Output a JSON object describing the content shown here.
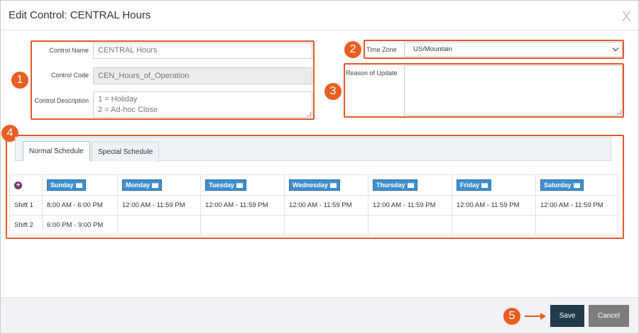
{
  "dialog": {
    "title": "Edit Control: CENTRAL Hours",
    "close_glyph": "X"
  },
  "callouts": [
    "1",
    "2",
    "3",
    "4",
    "5"
  ],
  "form": {
    "control_name_label": "Control Name",
    "control_name_value": "CENTRAL Hours",
    "control_code_label": "Control Code",
    "control_code_value": "CEN_Hours_of_Operation",
    "control_description_label": "Control Description",
    "control_description_line1": "1 = Holiday",
    "control_description_line2": "2 = Ad-hoc Close",
    "time_zone_label": "Time Zone",
    "time_zone_value": "US/Mountain",
    "reason_label": "Reason of Update",
    "reason_value": ""
  },
  "tabs": [
    {
      "label": "Normal Schedule",
      "active": true
    },
    {
      "label": "Special Schedule",
      "active": false
    }
  ],
  "schedule": {
    "days": [
      "Sunday",
      "Monday",
      "Tuesday",
      "Wednesday",
      "Thursday",
      "Friday",
      "Saturday"
    ],
    "rows": [
      {
        "label": "Shift 1",
        "cells": [
          "8:00 AM - 6:00 PM",
          "12:00 AM - 11:59 PM",
          "12:00 AM - 11:59 PM",
          "12:00 AM - 11:59 PM",
          "12:00 AM - 11:59 PM",
          "12:00 AM - 11:59 PM",
          "12:00 AM - 11:59 PM"
        ]
      },
      {
        "label": "Shift 2",
        "cells": [
          "6:00 PM - 9:00 PM",
          "",
          "",
          "",
          "",
          "",
          ""
        ]
      }
    ]
  },
  "footer": {
    "save_label": "Save",
    "cancel_label": "Cancel"
  },
  "colors": {
    "accent": "#e05a2a",
    "save_bg": "#203c4c",
    "cancel_bg": "#7d7d7d",
    "day_button": "#3f8fcf"
  }
}
